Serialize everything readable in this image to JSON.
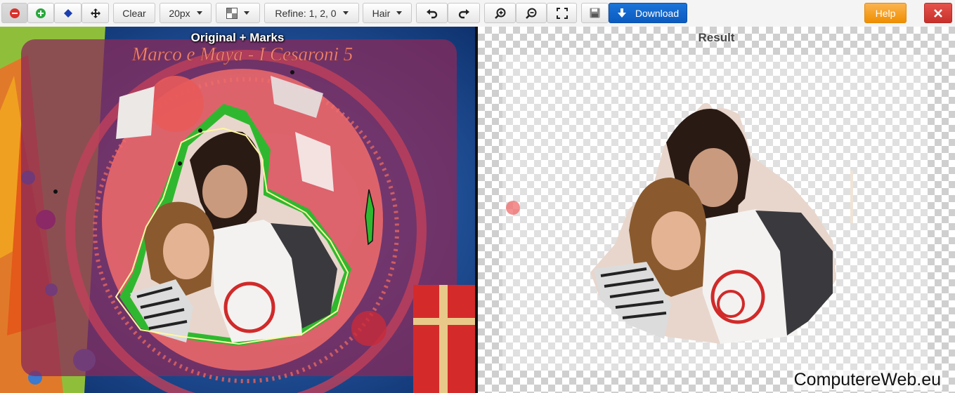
{
  "toolbar": {
    "mode_remove": {
      "icon": "minus-circle-icon",
      "color": "#d9302b"
    },
    "mode_keep": {
      "icon": "plus-circle-icon",
      "color": "#27a83a"
    },
    "mode_eraser": {
      "icon": "eraser-icon",
      "color": "#1c3fae"
    },
    "mode_pan": {
      "icon": "move-icon"
    },
    "clear_label": "Clear",
    "brush_size": "20px",
    "background_icon": "checkerboard-icon",
    "refine_label": "Refine: 1, 2, 0",
    "hair_label": "Hair",
    "undo_icon": "undo-icon",
    "redo_icon": "redo-icon",
    "zoom_in_icon": "zoom-in-icon",
    "zoom_out_icon": "zoom-out-icon",
    "fit_icon": "fullscreen-icon",
    "save_icon": "save-icon",
    "download_label": "Download",
    "help_label": "Help",
    "close_icon": "close-icon"
  },
  "colors": {
    "accent_blue": "#0b63c9",
    "help_orange": "#f59a0b",
    "close_red": "#d9302b",
    "keep_green": "#2fb82f",
    "remove_red": "#f06b6b"
  },
  "panes": {
    "left_title": "Original + Marks",
    "left_image_text": "Marco e Maya - I Cesaroni 5",
    "right_title": "Result"
  },
  "watermark": "ComputereWeb.eu"
}
